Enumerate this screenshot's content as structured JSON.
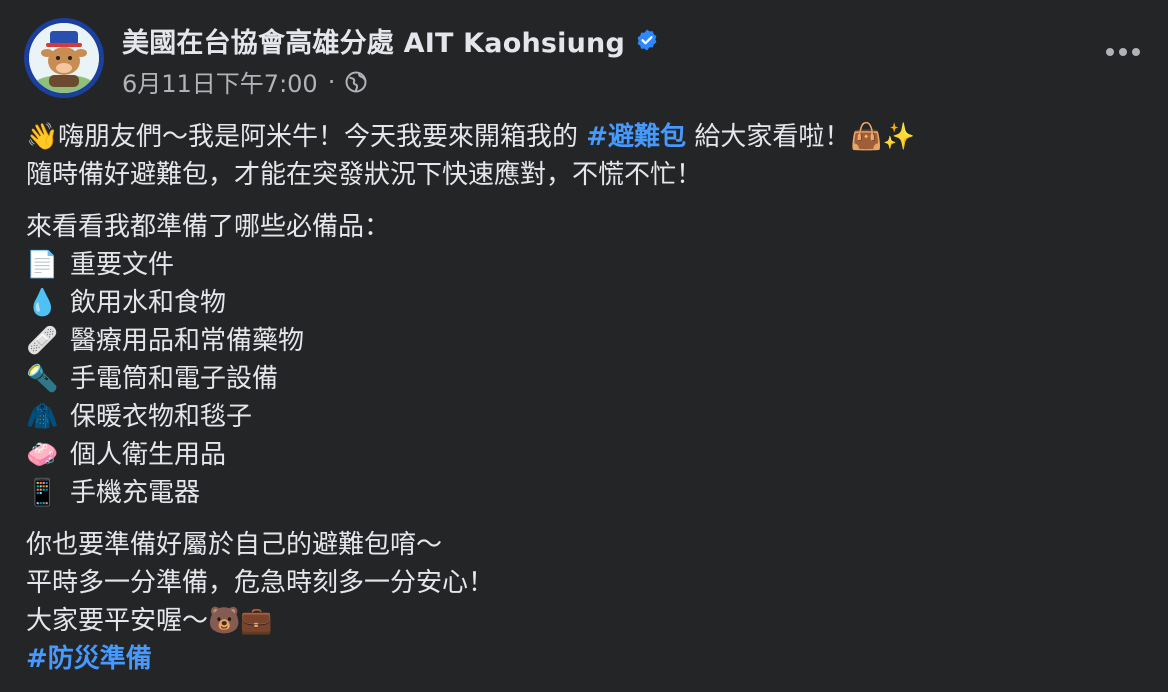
{
  "post": {
    "page_name": "美國在台協會高雄分處 AIT Kaohsiung",
    "timestamp": "6月11日下午7:00",
    "separator": "·",
    "icons": {
      "verified": "verified-badge-icon",
      "audience": "globe-icon",
      "more": "more-options-icon",
      "avatar": "page-avatar"
    },
    "colors": {
      "background": "#242526",
      "text": "#e4e6eb",
      "secondary_text": "#b0b3b8",
      "hashtag": "#4599ff",
      "verified": "#2d88ff"
    }
  },
  "content": {
    "intro": {
      "wave_emoji": "👋",
      "line1_text": "嗨朋友們～我是阿米牛！今天我要來開箱我的 ",
      "hashtag1": "#避難包",
      "line1_tail": " 給大家看啦！",
      "line1_end_emojis": "👜✨",
      "line2": "隨時備好避難包，才能在突發狀況下快速應對，不慌不忙！"
    },
    "list_heading": "來看看我都準備了哪些必備品：",
    "items": [
      {
        "emoji": "📄",
        "label": "重要文件"
      },
      {
        "emoji": "💧",
        "label": "飲用水和食物"
      },
      {
        "emoji": "🩹",
        "label": "醫療用品和常備藥物"
      },
      {
        "emoji": "🔦",
        "label": "手電筒和電子設備"
      },
      {
        "emoji": "🧥",
        "label": "保暖衣物和毯子"
      },
      {
        "emoji": "🧼",
        "label": "個人衛生用品"
      },
      {
        "emoji": "📱",
        "label": "手機充電器"
      }
    ],
    "closing": {
      "line1": "你也要準備好屬於自己的避難包唷～",
      "line2": "平時多一分準備，危急時刻多一分安心！",
      "line3_text": "大家要平安喔～",
      "line3_emojis": "🐻💼",
      "hashtag2": "#防災準備"
    }
  }
}
